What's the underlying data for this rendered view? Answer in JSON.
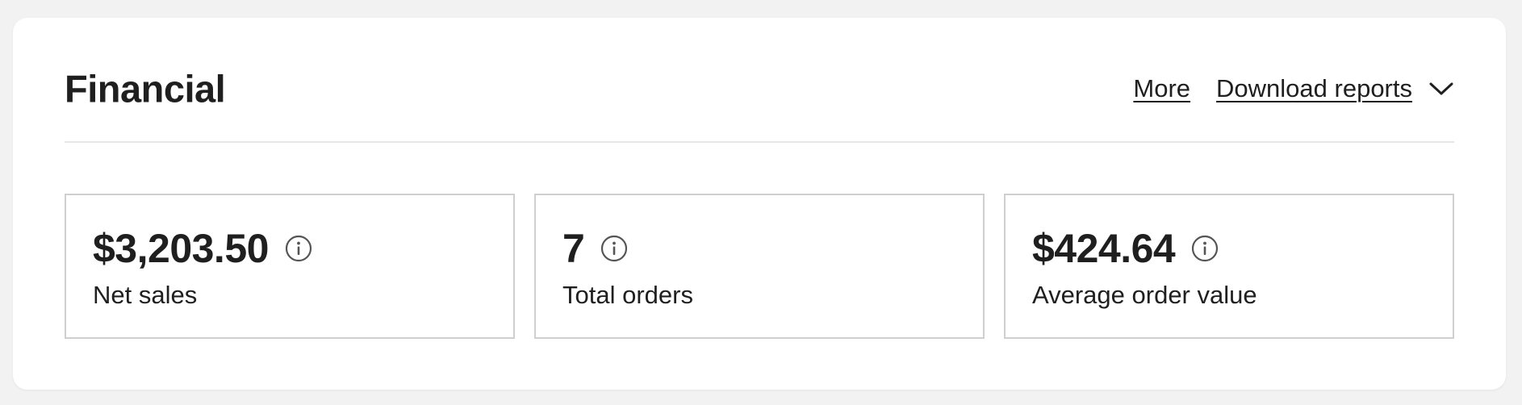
{
  "header": {
    "title": "Financial",
    "more_label": "More",
    "download_label": "Download reports"
  },
  "metrics": [
    {
      "value": "$3,203.50",
      "label": "Net sales"
    },
    {
      "value": "7",
      "label": "Total orders"
    },
    {
      "value": "$424.64",
      "label": "Average order value"
    }
  ],
  "icons": {
    "dropdown": "chevron-down-icon",
    "info": "info-icon"
  },
  "colors": {
    "text": "#1f1f1f",
    "border": "#cfcfcf",
    "divider": "#e6e6e6",
    "background": "#f2f2f2",
    "card": "#ffffff"
  }
}
